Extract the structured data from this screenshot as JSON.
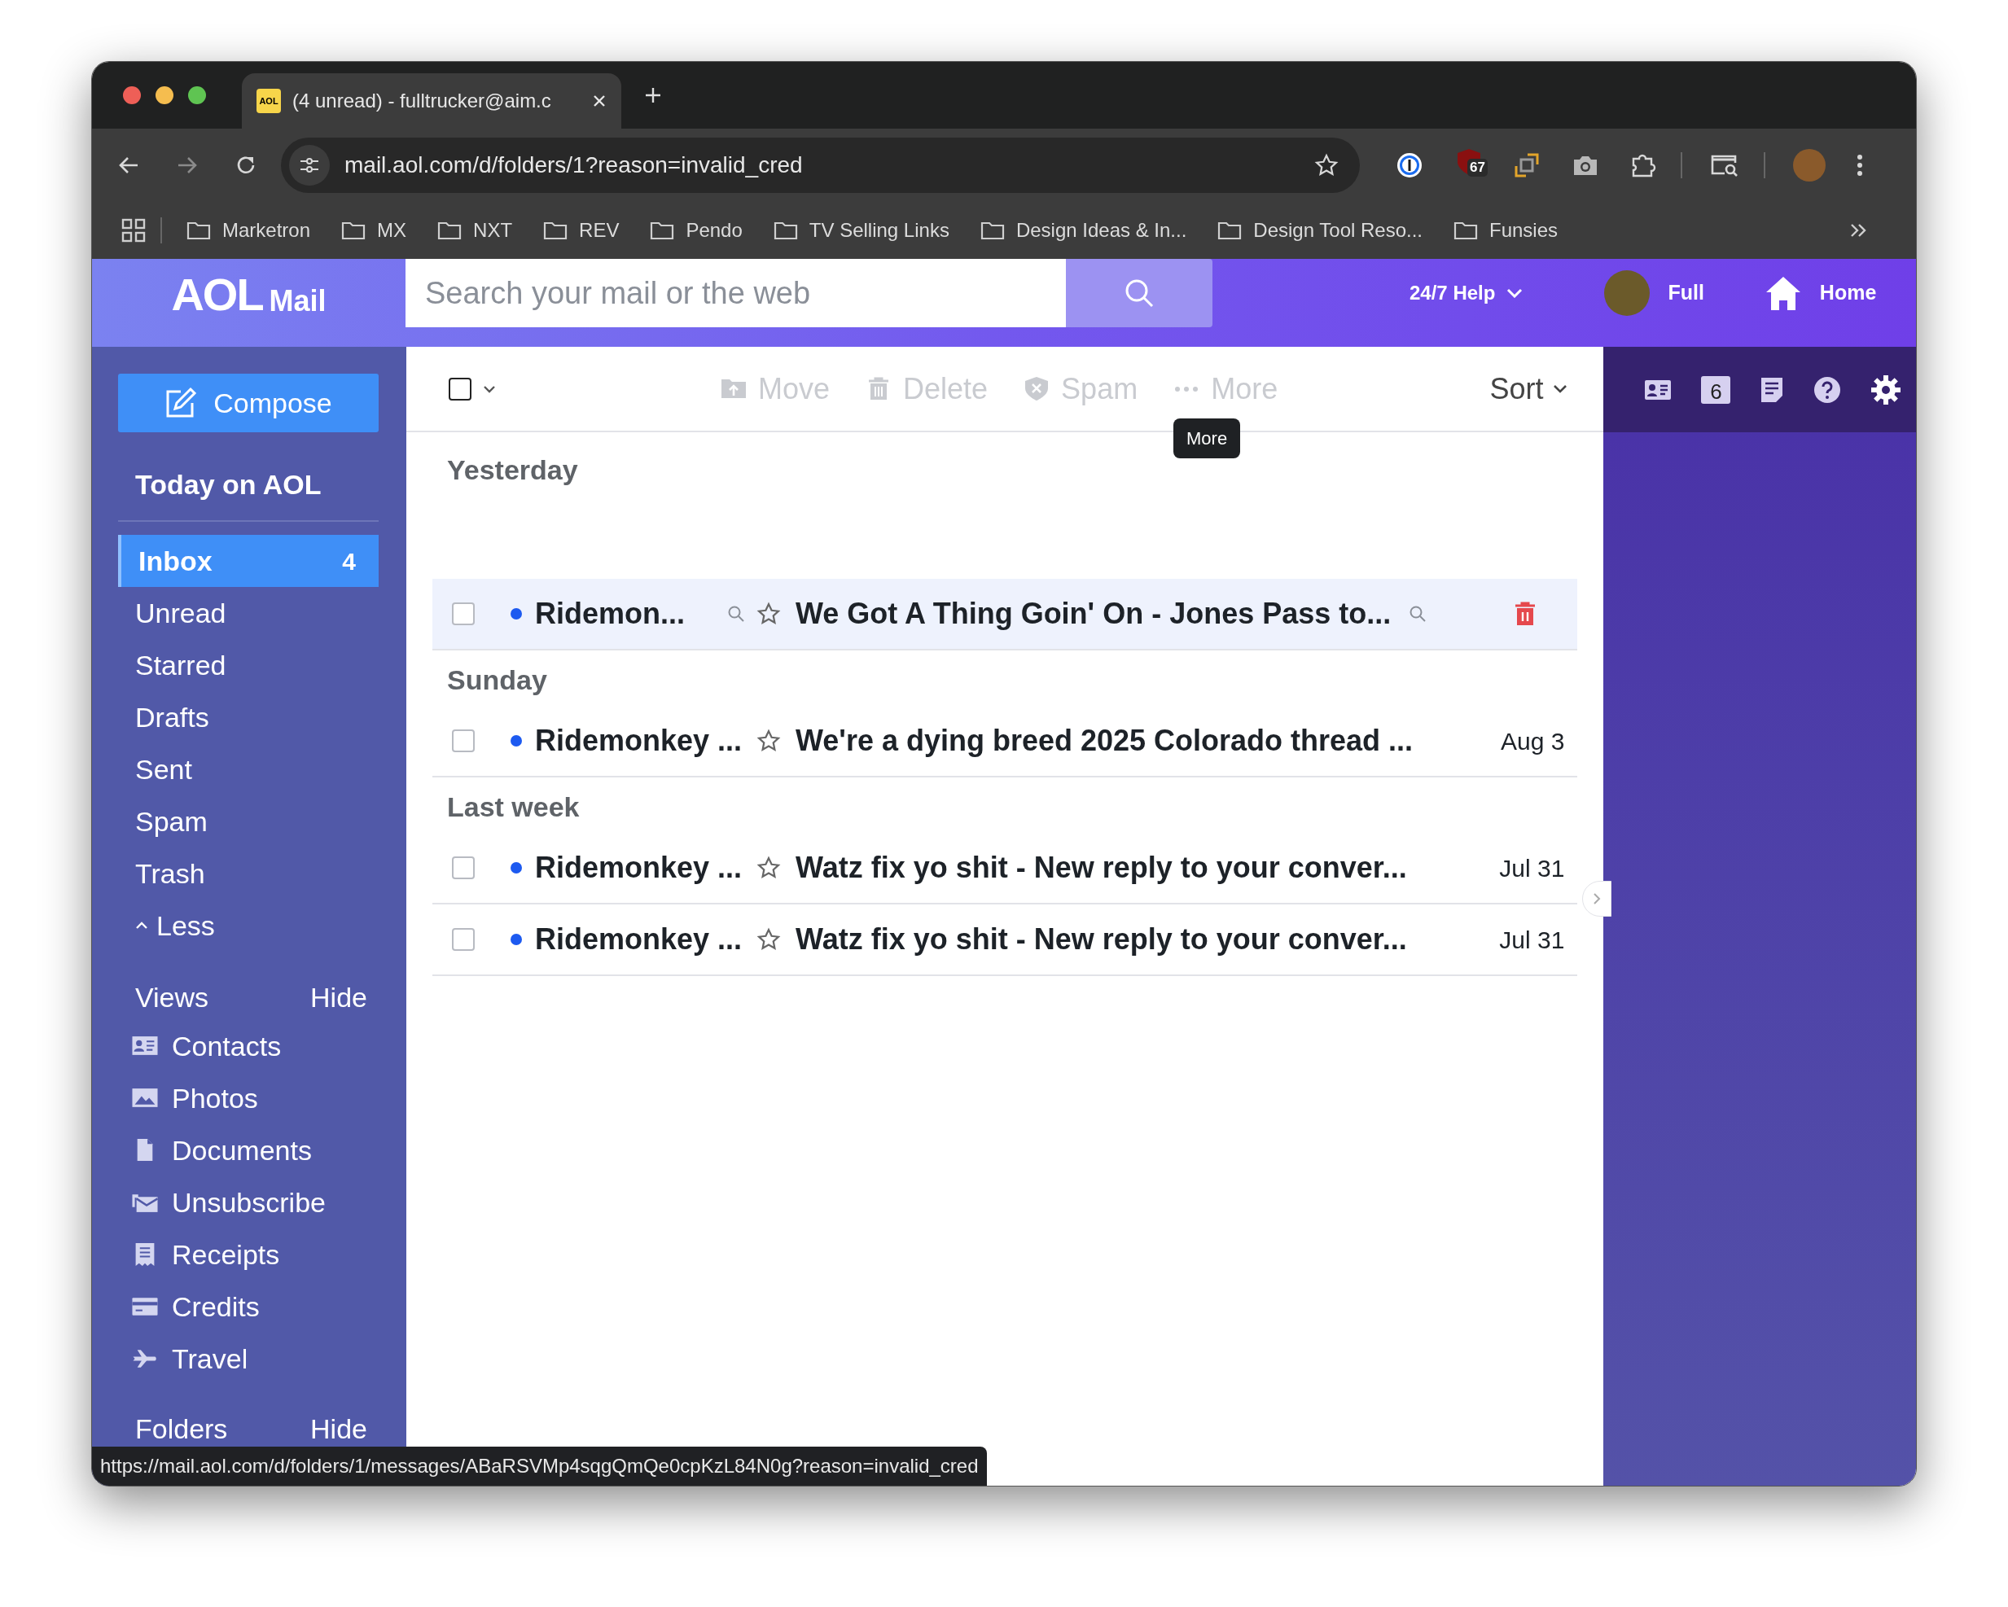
{
  "browser": {
    "tab": {
      "favicon": "AOL",
      "title": "(4 unread) - fulltrucker@aim.c"
    },
    "address": "mail.aol.com/d/folders/1?reason=invalid_cred",
    "extension_badge": "67",
    "bookmarks": [
      "Marketron",
      "MX",
      "NXT",
      "REV",
      "Pendo",
      "TV Selling Links",
      "Design Ideas & In...",
      "Design Tool Reso...",
      "Funsies"
    ],
    "status_url": "https://mail.aol.com/d/folders/1/messages/ABaRSVMp4sqgQmQe0cpKzL84N0g?reason=invalid_cred"
  },
  "header": {
    "logo": "AOL",
    "logo_sub": "Mail",
    "search": {
      "placeholder": "Search your mail or the web"
    },
    "help": "24/7 Help",
    "user": "Full",
    "home": "Home"
  },
  "sidebar": {
    "compose": "Compose",
    "today": "Today on AOL",
    "folders": [
      {
        "label": "Inbox",
        "count": "4",
        "selected": true
      },
      {
        "label": "Unread",
        "selected": false
      },
      {
        "label": "Starred",
        "selected": false
      },
      {
        "label": "Drafts",
        "selected": false
      },
      {
        "label": "Sent",
        "selected": false
      },
      {
        "label": "Spam",
        "selected": false
      },
      {
        "label": "Trash",
        "selected": false
      }
    ],
    "less": "Less",
    "views": {
      "title": "Views",
      "toggle": "Hide",
      "items": [
        {
          "kind": "contacts",
          "label": "Contacts"
        },
        {
          "kind": "photos",
          "label": "Photos"
        },
        {
          "kind": "documents",
          "label": "Documents"
        },
        {
          "kind": "unsubscribe",
          "label": "Unsubscribe"
        },
        {
          "kind": "receipts",
          "label": "Receipts"
        },
        {
          "kind": "credits",
          "label": "Credits"
        },
        {
          "kind": "travel",
          "label": "Travel"
        }
      ]
    },
    "folders_section": {
      "title": "Folders",
      "toggle": "Hide"
    }
  },
  "toolbar": {
    "actions": [
      {
        "kind": "move",
        "label": "Move",
        "disabled": true
      },
      {
        "kind": "delete",
        "label": "Delete",
        "disabled": true
      },
      {
        "kind": "spam",
        "label": "Spam",
        "disabled": true
      },
      {
        "kind": "more",
        "label": "More",
        "disabled": true
      }
    ],
    "sort": "Sort",
    "tooltip": "More",
    "select_all": {
      "checked": false
    }
  },
  "groups": [
    {
      "label": "Yesterday",
      "messages": [
        {
          "sender": "Ridemon...",
          "subject": "We Got A Thing Goin' On - Jones Pass to...",
          "unread": true,
          "starred": false,
          "highlighted": true
        }
      ]
    },
    {
      "label": "Sunday",
      "messages": [
        {
          "sender": "Ridemonkey ...",
          "subject": "We're a dying breed 2025 Colorado thread ...",
          "date": "Aug 3",
          "unread": true,
          "starred": false,
          "highlighted": false
        }
      ]
    },
    {
      "label": "Last week",
      "messages": [
        {
          "sender": "Ridemonkey ...",
          "subject": "Watz fix yo shit - New reply to your conver...",
          "date": "Jul 31",
          "unread": true,
          "starred": false,
          "highlighted": false
        },
        {
          "sender": "Ridemonkey ...",
          "subject": "Watz fix yo shit - New reply to your conver...",
          "date": "Jul 31",
          "unread": true,
          "starred": false,
          "highlighted": false
        }
      ]
    }
  ],
  "right_panel": {
    "calendar_day": "6"
  }
}
